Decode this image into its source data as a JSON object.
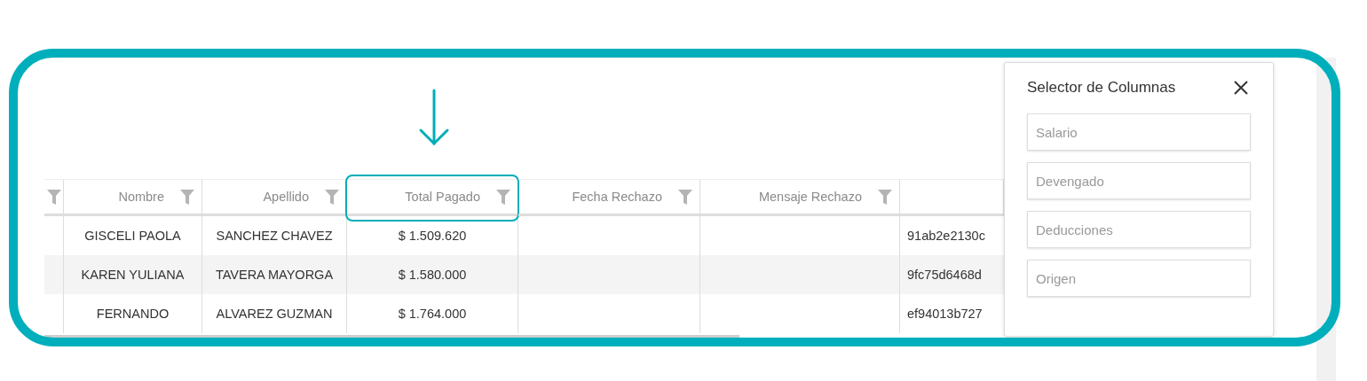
{
  "table": {
    "columns": [
      {
        "filter": true
      },
      {
        "label": "Nombre",
        "filter": true,
        "highlighted": false
      },
      {
        "label": "Apellido",
        "filter": true,
        "highlighted": false
      },
      {
        "label": "Total Pagado",
        "filter": true,
        "highlighted": true
      },
      {
        "label": "Fecha Rechazo",
        "filter": true,
        "highlighted": false
      },
      {
        "label": "Mensaje Rechazo",
        "filter": true,
        "highlighted": false
      },
      {
        "filter": false
      }
    ],
    "rows": [
      {
        "nombre": "GISCELI PAOLA",
        "apellido": "SANCHEZ CHAVEZ",
        "total_pagado": "$ 1.509.620",
        "column_7": "91ab2e2130c"
      },
      {
        "nombre": "KAREN YULIANA",
        "apellido": "TAVERA MAYORGA",
        "total_pagado": "$ 1.580.000",
        "column_7": "9fc75d6468d"
      },
      {
        "nombre": "FERNANDO",
        "apellido": "ALVAREZ GUZMAN",
        "total_pagado": "$ 1.764.000",
        "column_7": "ef94013b727"
      }
    ]
  },
  "column_selector": {
    "title": "Selector de Columnas",
    "fields": [
      {
        "placeholder": "Salario"
      },
      {
        "placeholder": "Devengado"
      },
      {
        "placeholder": "Deducciones"
      },
      {
        "placeholder": "Origen"
      }
    ]
  }
}
